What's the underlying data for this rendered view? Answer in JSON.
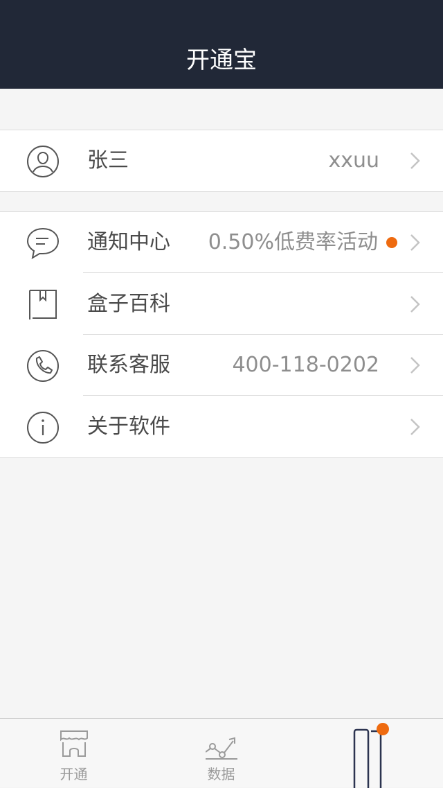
{
  "header": {
    "title": "开通宝"
  },
  "profile": {
    "name": "张三",
    "account": "xxuu",
    "icon": "user-icon"
  },
  "menu": [
    {
      "label": "通知中心",
      "value": "0.50%低费率活动",
      "icon": "message-icon",
      "has_badge": true
    },
    {
      "label": "盒子百科",
      "value": "",
      "icon": "bookmark-icon"
    },
    {
      "label": "联系客服",
      "value": "400-118-0202",
      "icon": "phone-icon"
    },
    {
      "label": "关于软件",
      "value": "",
      "icon": "info-icon"
    }
  ],
  "tabbar": {
    "tabs": [
      {
        "label": "开通",
        "icon": "store-icon"
      },
      {
        "label": "数据",
        "icon": "chart-icon"
      },
      {
        "label": "",
        "icon": "profile-tab-icon",
        "has_badge": true
      }
    ]
  },
  "colors": {
    "nav_bg": "#212837",
    "badge": "#ee6a0f"
  }
}
